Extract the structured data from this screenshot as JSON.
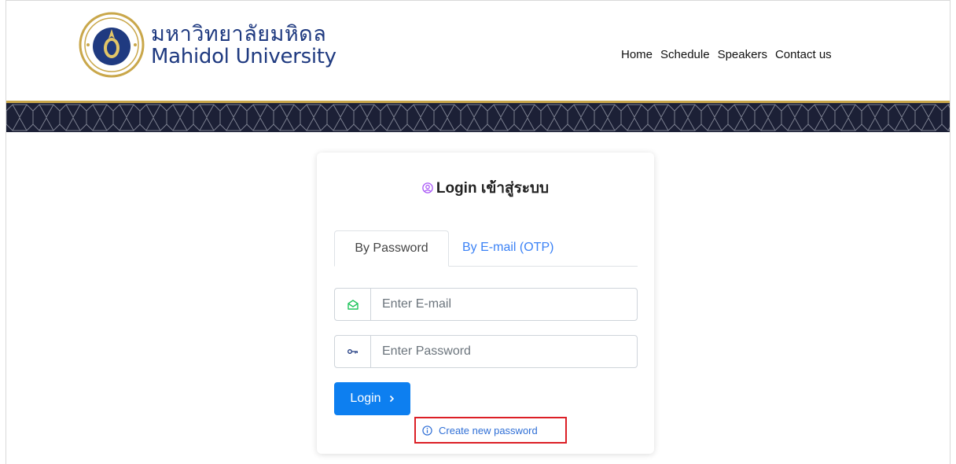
{
  "header": {
    "brand_thai": "มหาวิทยาลัยมหิดล",
    "brand_en": "Mahidol University",
    "nav": [
      "Home",
      "Schedule",
      "Speakers",
      "Contact us"
    ]
  },
  "login": {
    "title": "Login เข้าสู่ระบบ",
    "tabs": [
      "By Password",
      "By E-mail (OTP)"
    ],
    "email_placeholder": "Enter E-mail",
    "password_placeholder": "Enter Password",
    "login_label": "Login",
    "create_password_label": "Create new password"
  },
  "icons": {
    "title": "user-circle-icon",
    "email": "envelope-open-icon",
    "password": "key-icon",
    "login": "chevron-right-icon",
    "create": "info-circle-icon"
  },
  "colors": {
    "brand": "#1f3a80",
    "primary": "#0d7ff0",
    "link": "#3b82f6",
    "band": "#1c2036",
    "gold": "#c9a74a",
    "highlight": "#dc1f26",
    "title_icon": "#a855f7",
    "email_icon": "#22c55e"
  }
}
